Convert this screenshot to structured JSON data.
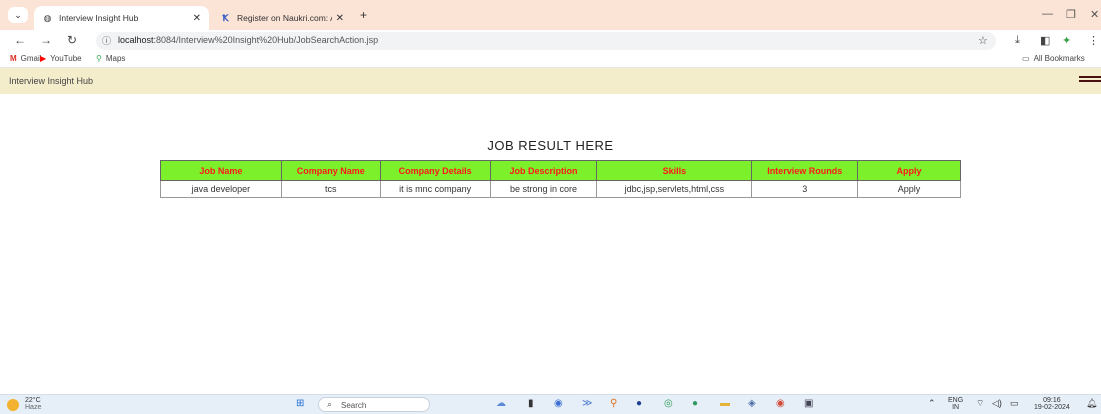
{
  "browser": {
    "tabs": [
      {
        "title": "Interview Insight Hub",
        "active": true
      },
      {
        "title": "Register on Naukri.com: Apply",
        "active": false
      }
    ],
    "url_host": "localhost",
    "url_rest": ":8084/Interview%20Insight%20Hub/JobSearchAction.jsp",
    "bookmarks": [
      {
        "label": "Gmail",
        "icon": "gmail-icon"
      },
      {
        "label": "YouTube",
        "icon": "youtube-icon"
      },
      {
        "label": "Maps",
        "icon": "maps-icon"
      }
    ],
    "all_bookmarks": "All Bookmarks"
  },
  "app": {
    "title": "Interview Insight Hub",
    "heading": "JOB RESULT HERE"
  },
  "table": {
    "headers": [
      "Job Name",
      "Company Name",
      "Company Details",
      "Job Description",
      "Skills",
      "Interview Rounds",
      "Apply"
    ],
    "rows": [
      [
        "java developer",
        "tcs",
        "it is mnc company",
        "be strong in core",
        "jdbc,jsp,servlets,html,css",
        "3",
        "Apply"
      ]
    ]
  },
  "colors": {
    "header_bg": "#7cf02a",
    "header_text": "#ff1a1a",
    "app_bar_bg": "#f3edcc",
    "tabstrip_bg": "#fbe3d6"
  },
  "taskbar": {
    "weather_temp": "22°C",
    "weather_desc": "Haze",
    "search_label": "Search",
    "lang_top": "ENG",
    "lang_bottom": "IN",
    "time": "09:16",
    "date": "19-02-2024"
  }
}
